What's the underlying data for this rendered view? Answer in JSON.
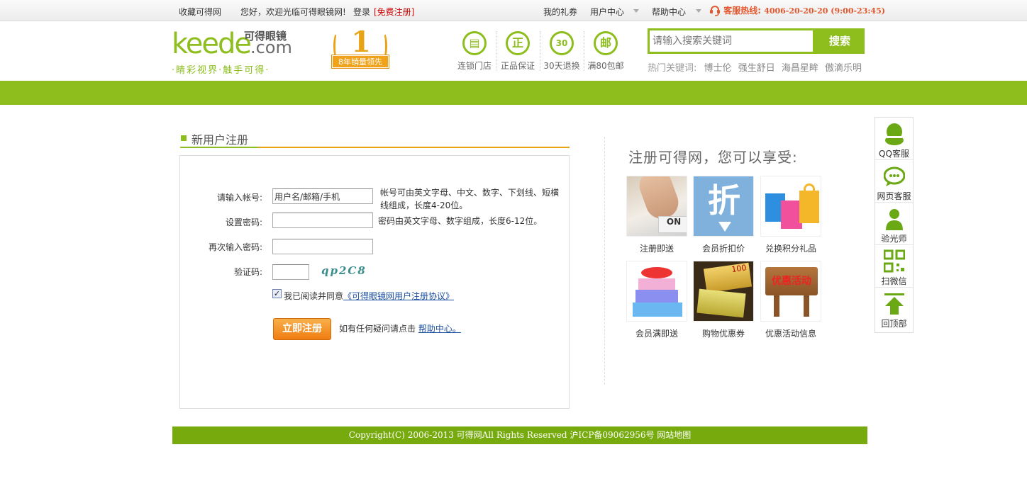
{
  "topbar": {
    "favorite": "收藏可得网",
    "welcome": "您好，欢迎光临可得眼镜网!",
    "login": "登录",
    "register": "[免费注册]",
    "gift_card": "我的礼券",
    "user_center": "用户中心",
    "help_center": "帮助中心",
    "hotline_label": "客服热线:",
    "hotline_number": "4006-20-20-20 (9:00-23:45)"
  },
  "header": {
    "logo_text_keede": "keede",
    "logo_text_com": ".com",
    "logo_cn": "可得眼镜",
    "slogan": "·睛彩视界·触手可得·",
    "badge_number": "1",
    "badge_ribbon": "8年销量领先",
    "features": [
      {
        "icon": "store-icon",
        "glyph": "▤",
        "label": "连锁门店"
      },
      {
        "icon": "genuine-icon",
        "glyph": "正",
        "label": "正品保证"
      },
      {
        "icon": "return-30-icon",
        "glyph": "30",
        "label": "30天退换"
      },
      {
        "icon": "free-shipping-icon",
        "glyph": "邮",
        "label": "满80包邮"
      }
    ],
    "search": {
      "placeholder": "请输入搜索关键词",
      "button": "搜索"
    },
    "hot": {
      "label": "热门关键词:",
      "keywords": [
        "博士伦",
        "强生舒日",
        "海昌星眸",
        "傲滴乐明"
      ]
    }
  },
  "register": {
    "title": "新用户注册",
    "account_label": "请输入帐号:",
    "account_value": "用户名/邮箱/手机",
    "account_hint": "帐号可由英文字母、中文、数字、下划线、短横线组成，长度4-20位。",
    "password_label": "设置密码:",
    "password_hint": "密码由英文字母、数字组成，长度6-12位。",
    "password2_label": "再次输入密码:",
    "captcha_label": "验证码:",
    "captcha_text": "qp2C8",
    "agree_text": "我已阅读并同意",
    "agree_link": "《可得眼镜网用户注册协议》",
    "submit": "立即注册",
    "help_text": "如有任何疑问请点击",
    "help_link": "帮助中心。"
  },
  "benefits": {
    "title": "注册可得网，您可以享受:",
    "items": [
      {
        "label": "注册即送"
      },
      {
        "label": "会员折扣价",
        "img_text": "折"
      },
      {
        "label": "兑换积分礼品"
      },
      {
        "label": "会员满即送"
      },
      {
        "label": "购物优惠券",
        "img_text": "100"
      },
      {
        "label": "优惠活动信息",
        "img_text": "优惠活动"
      }
    ]
  },
  "side_tools": [
    {
      "label": "QQ客服"
    },
    {
      "label": "网页客服"
    },
    {
      "label": "验光师"
    },
    {
      "label": "扫微信"
    },
    {
      "label": "回顶部"
    }
  ],
  "footer": {
    "text": "Copyright(C) 2006-2013 可得网All Rights Reserved 沪ICP备09062956号 网站地图"
  },
  "colors": {
    "brand_green": "#8dbe1e",
    "footer_green": "#76aa0d",
    "accent_orange": "#e9a316",
    "hotline_orange": "#e4572e",
    "link_blue": "#1e50a2"
  }
}
